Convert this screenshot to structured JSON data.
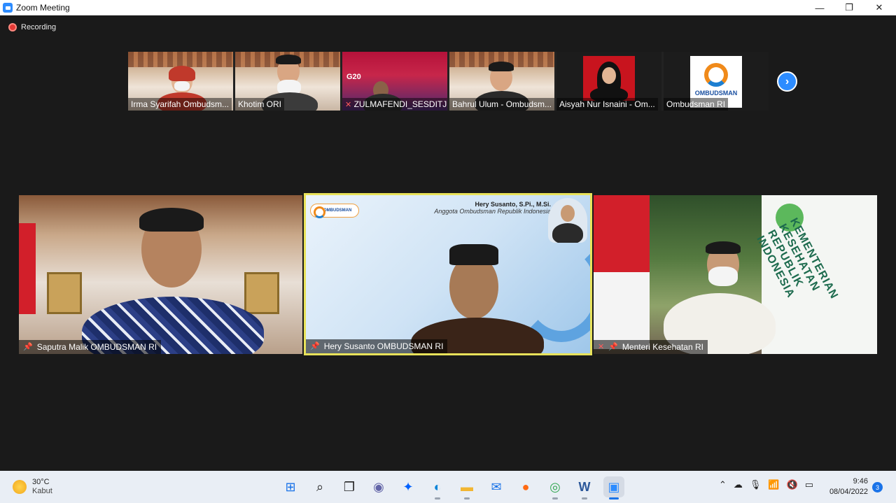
{
  "window": {
    "title": "Zoom Meeting",
    "minimize": "—",
    "maximize": "❐",
    "close": "✕"
  },
  "recording": {
    "label": "Recording"
  },
  "thumbnails": [
    {
      "label": "Irma Syarifah Ombudsm..."
    },
    {
      "label": "Khotim ORI"
    },
    {
      "label": "ZULMAFENDI_SESDITJ...",
      "muted": true
    },
    {
      "label": "Bahrul Ulum - Ombudsm..."
    },
    {
      "label": "Aisyah Nur Isnaini - Om..."
    },
    {
      "label": "Ombudsman RI",
      "logo_text": "OMBUDSMAN"
    }
  ],
  "g20_text": "G20",
  "next_button": "›",
  "tiles": [
    {
      "label": "Saputra Malik OMBUDSMAN RI",
      "pinned": true
    },
    {
      "label": "Hery Susanto OMBUDSMAN RI",
      "pinned": true,
      "speaker": true,
      "heading_name": "Hery Susanto, S.Pi., M.Si.",
      "heading_role": "Anggota Ombudsman Republik Indonesia",
      "logo_text": "OMBUDSMAN"
    },
    {
      "label": "Menteri Kesehatan RI",
      "pinned": true,
      "muted": true,
      "banner_text": "KEMENTERIAN KESEHATAN REPUBLIK INDONESIA"
    }
  ],
  "taskbar": {
    "weather": {
      "temp": "30°C",
      "condition": "Kabut"
    },
    "clock": {
      "time": "9:46",
      "date": "08/04/2022"
    },
    "notifications": "3"
  },
  "colors": {
    "accent": "#2d8cff",
    "speaker_border": "#e8e25a",
    "recording": "#e53935"
  }
}
